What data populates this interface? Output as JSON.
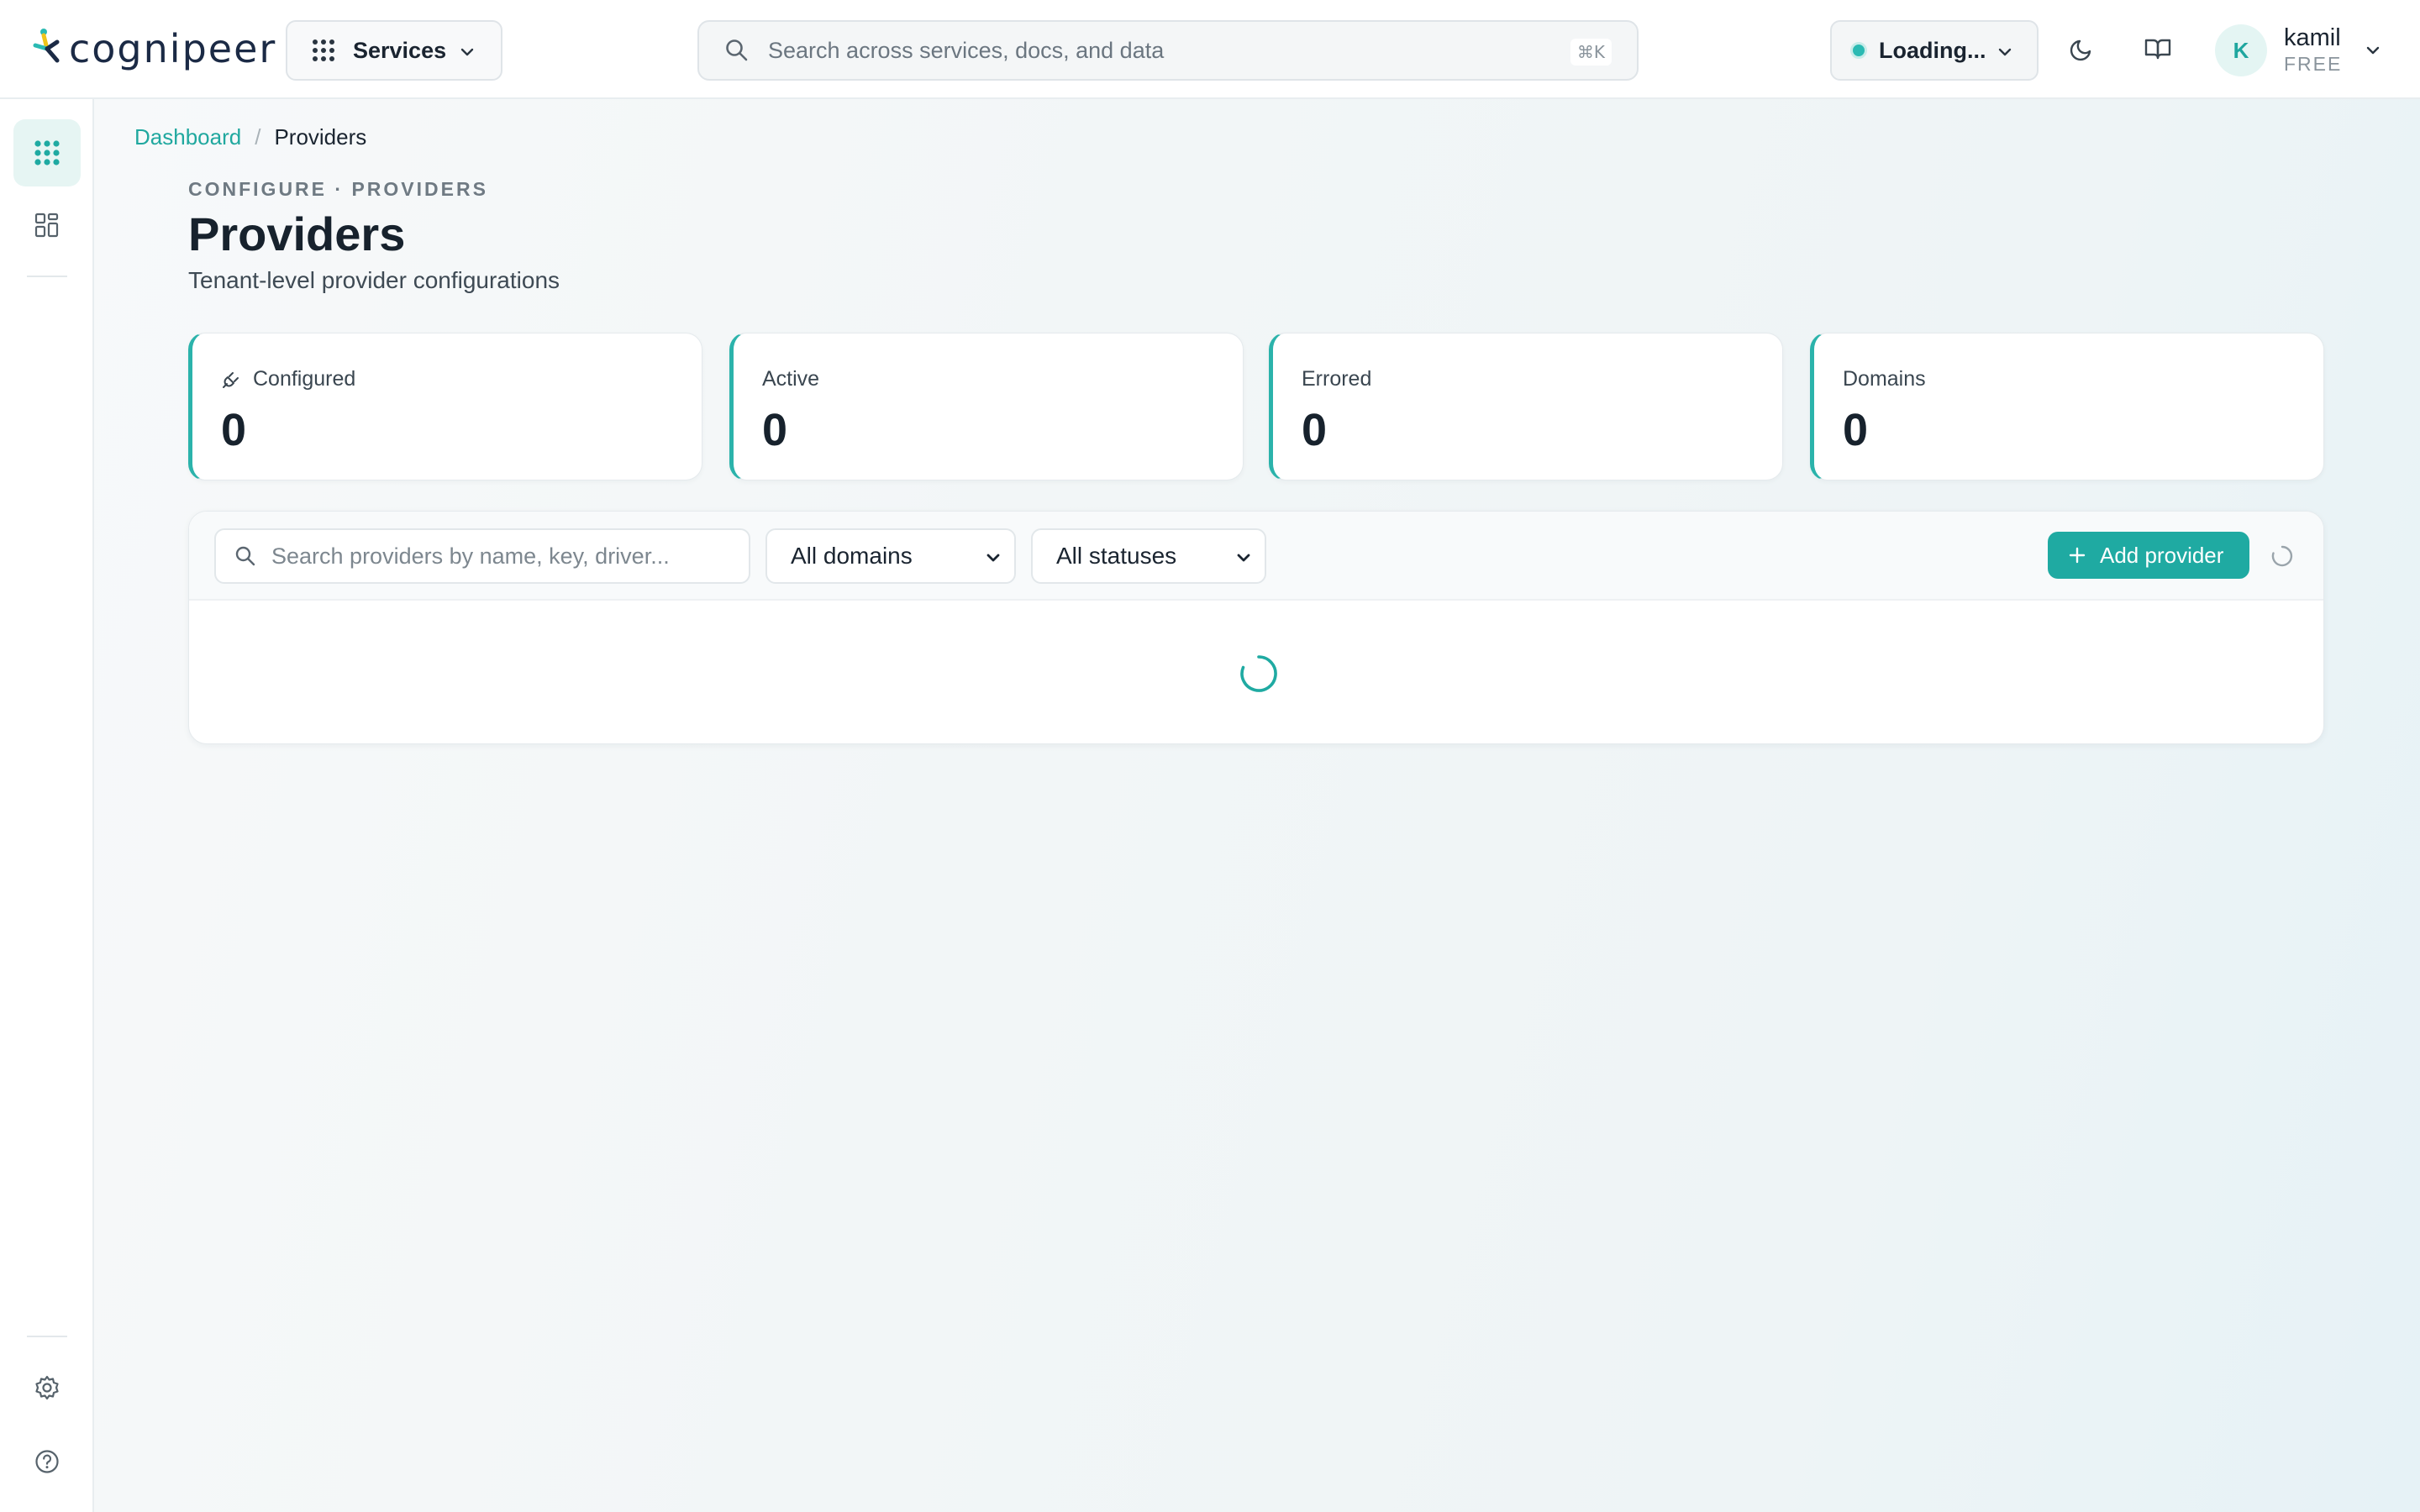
{
  "brand": {
    "name": "cognipeer",
    "accent": "#1faaa2"
  },
  "topbar": {
    "services_label": "Services",
    "search_placeholder": "Search across services, docs, and data",
    "search_shortcut": "⌘K",
    "workspace_status": "Loading...",
    "theme_icon": "moon-icon",
    "docs_icon": "book-icon"
  },
  "user": {
    "initial": "K",
    "name": "kamil",
    "plan": "FREE"
  },
  "sidebar": {
    "items": [
      {
        "icon": "apps-grid-icon",
        "active": true
      },
      {
        "icon": "dashboard-icon",
        "active": false
      }
    ],
    "bottom": [
      {
        "icon": "settings-icon"
      },
      {
        "icon": "help-icon"
      }
    ]
  },
  "breadcrumb": {
    "root": "Dashboard",
    "separator": "/",
    "current": "Providers"
  },
  "page": {
    "eyebrow": "CONFIGURE · PROVIDERS",
    "title": "Providers",
    "subtitle": "Tenant-level provider configurations"
  },
  "stats": [
    {
      "label": "Configured",
      "value": "0",
      "icon": "plug-icon"
    },
    {
      "label": "Active",
      "value": "0"
    },
    {
      "label": "Errored",
      "value": "0"
    },
    {
      "label": "Domains",
      "value": "0"
    }
  ],
  "filters": {
    "search_placeholder": "Search providers by name, key, driver...",
    "domain_selected": "All domains",
    "status_selected": "All statuses",
    "add_label": "Add provider"
  }
}
